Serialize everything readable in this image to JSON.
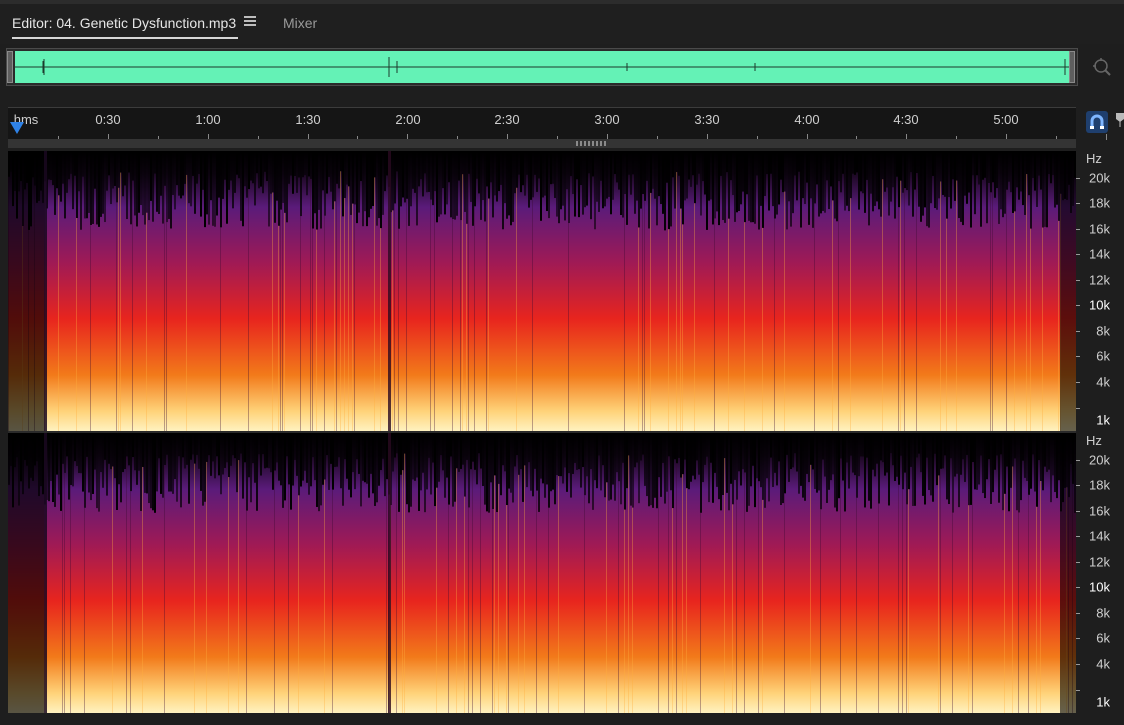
{
  "tabs": {
    "editor_label": "Editor: 04. Genetic Dysfunction.mp3",
    "mixer_label": "Mixer"
  },
  "timeline": {
    "format_label": "hms",
    "labels": [
      "0:30",
      "1:00",
      "1:30",
      "2:00",
      "2:30",
      "3:00",
      "3:30",
      "4:00",
      "4:30",
      "5:00"
    ]
  },
  "frequency_axis": {
    "unit": "Hz",
    "labels": [
      "20k",
      "18k",
      "16k",
      "14k",
      "12k",
      "10k",
      "8k",
      "6k",
      "4k",
      "1k"
    ]
  },
  "colors": {
    "overview_waveform": "#64f2b6",
    "playhead": "#2f82e6",
    "spectrogram_low": "#ffd37a",
    "spectrogram_mid": "#e8251e",
    "spectrogram_high": "#5a1b7a"
  },
  "icons": {
    "tab_menu": "hamburger-menu-icon",
    "zoom": "zoom-to-fit-icon",
    "snap": "snapping-magnet-icon",
    "marker": "marker-icon",
    "playhead": "playhead-marker-icon"
  }
}
